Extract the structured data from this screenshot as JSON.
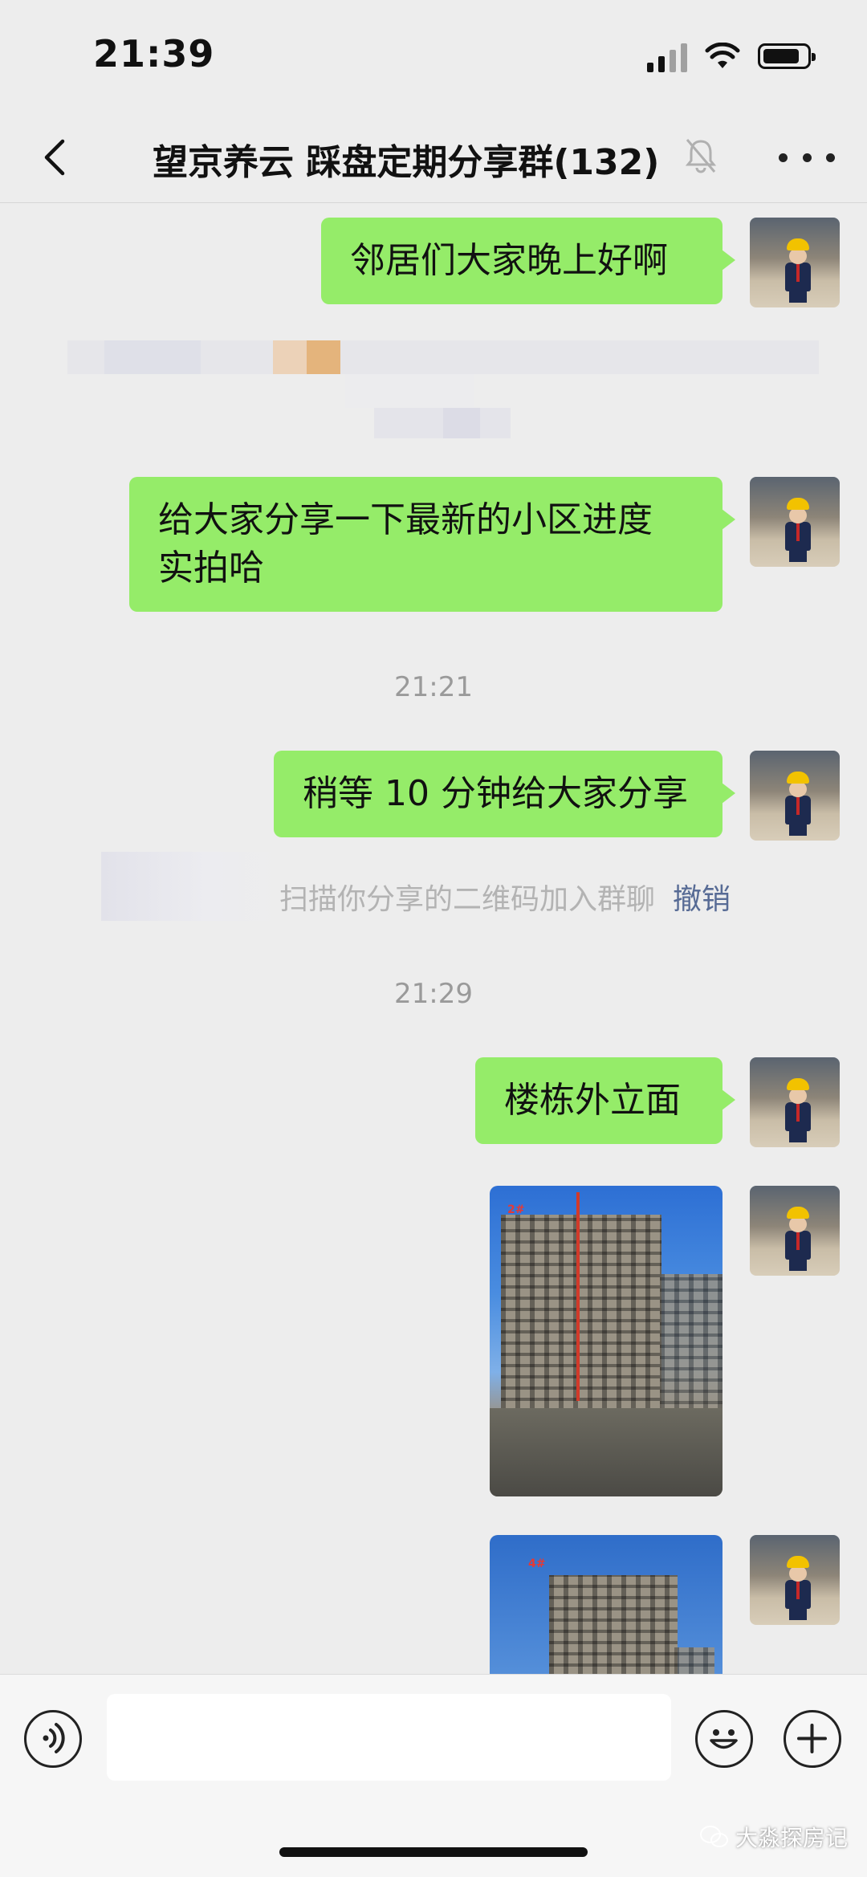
{
  "status_bar": {
    "time": "21:39"
  },
  "header": {
    "title": "望京养云 踩盘定期分享群(132)"
  },
  "messages": [
    {
      "text": "邻居们大家晚上好啊"
    },
    {
      "text": "给大家分享一下最新的小区进度\n实拍哈"
    },
    {
      "timestamp": "21:21"
    },
    {
      "text": "稍等 10 分钟给大家分享"
    },
    {
      "system": "扫描你分享的二维码加入群聊",
      "action": "撤销"
    },
    {
      "timestamp": "21:29"
    },
    {
      "text": "楼栋外立面"
    }
  ],
  "photos": [
    {
      "mark": "2#"
    },
    {
      "mark": "4#"
    }
  ],
  "input": {
    "placeholder": ""
  },
  "watermark": {
    "text": "大淼探房记"
  }
}
